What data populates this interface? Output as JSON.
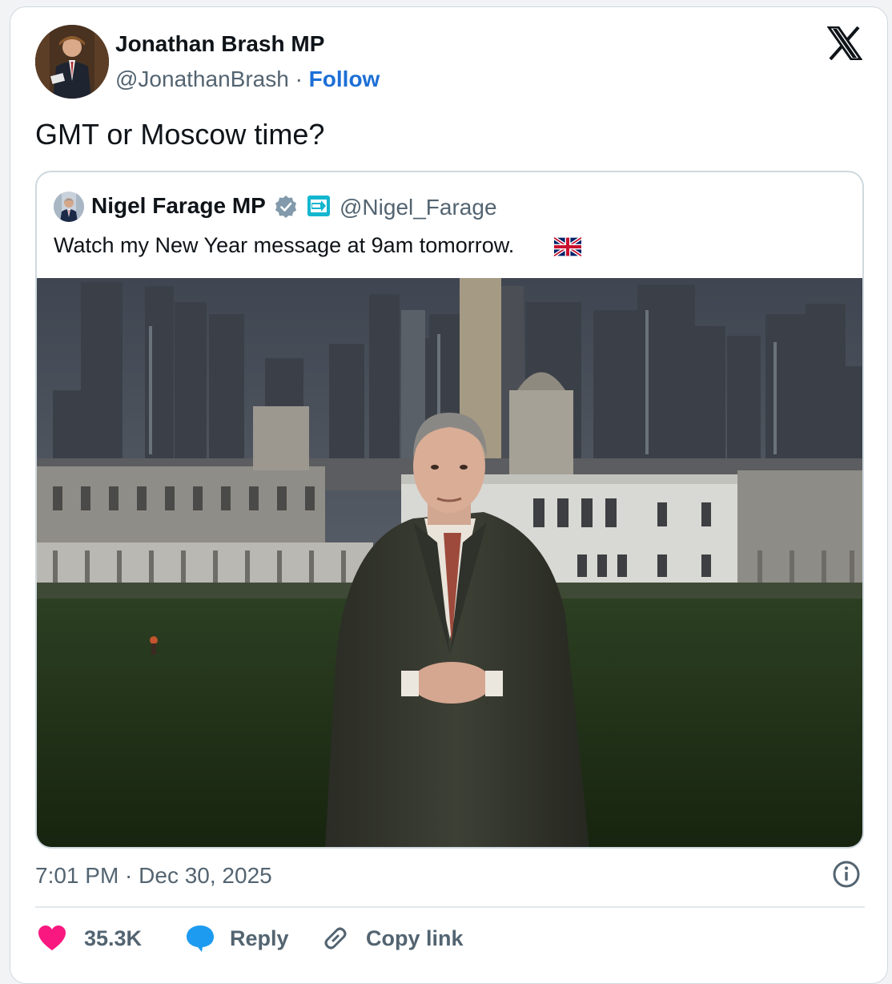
{
  "author": {
    "name": "Jonathan Brash MP",
    "handle": "@JonathanBrash",
    "separator": "·",
    "follow_label": "Follow"
  },
  "tweet": {
    "text": "GMT or Moscow time?",
    "timestamp": "7:01 PM · Dec 30, 2025"
  },
  "quoted_tweet": {
    "name": "Nigel Farage MP",
    "handle": "@Nigel_Farage",
    "text": "Watch my New Year message at 9am tomorrow.",
    "verified_icon": "verified-badge-icon",
    "affiliation_icon": "reform-uk-badge-icon",
    "flag_icon": "uk-flag-icon"
  },
  "actions": {
    "like_count": "35.3K",
    "reply_label": "Reply",
    "copy_label": "Copy link"
  },
  "colors": {
    "accent": "#1d6fd6",
    "like": "#f91880",
    "reply": "#1d9bf0",
    "muted": "#536471"
  }
}
